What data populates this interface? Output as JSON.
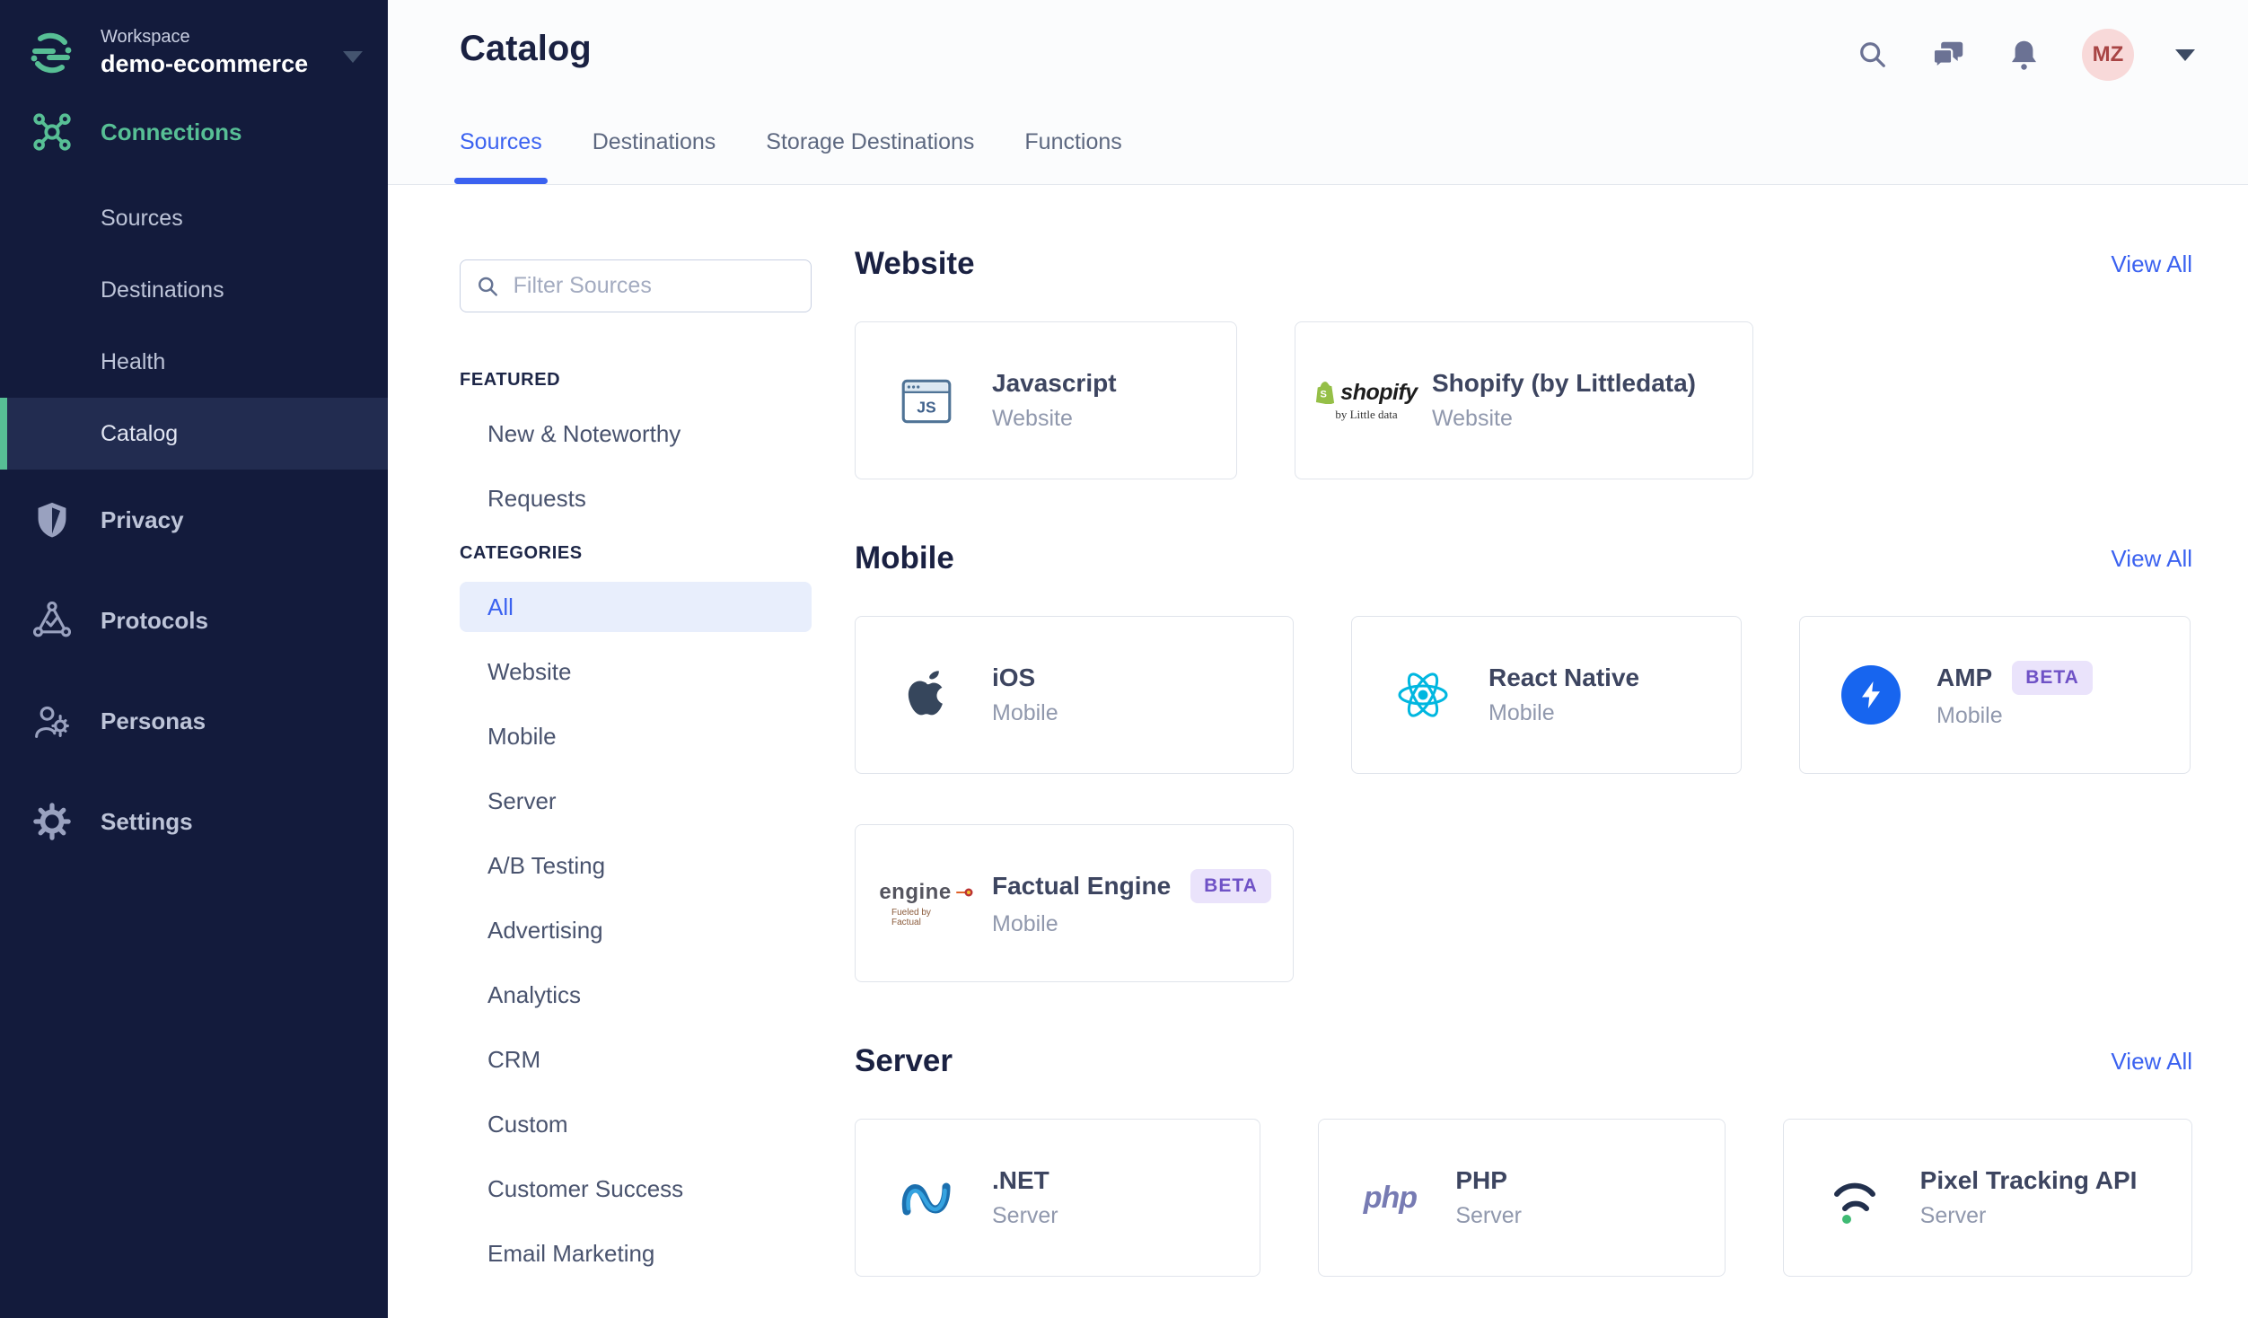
{
  "workspace": {
    "label": "Workspace",
    "name": "demo-ecommerce"
  },
  "sidebar": {
    "connections": {
      "label": "Connections",
      "icon": "connections-icon",
      "items": [
        {
          "label": "Sources",
          "active": false
        },
        {
          "label": "Destinations",
          "active": false
        },
        {
          "label": "Health",
          "active": false
        },
        {
          "label": "Catalog",
          "active": true
        }
      ]
    },
    "bottom": [
      {
        "label": "Privacy",
        "icon": "shield-icon"
      },
      {
        "label": "Protocols",
        "icon": "protocols-icon"
      },
      {
        "label": "Personas",
        "icon": "personas-icon"
      },
      {
        "label": "Settings",
        "icon": "settings-gear-icon"
      }
    ]
  },
  "header": {
    "title": "Catalog",
    "tabs": [
      {
        "label": "Sources",
        "active": true
      },
      {
        "label": "Destinations",
        "active": false
      },
      {
        "label": "Storage Destinations",
        "active": false
      },
      {
        "label": "Functions",
        "active": false
      }
    ],
    "icons": [
      "search-icon",
      "chat-icon",
      "bell-icon"
    ],
    "avatar": "MZ"
  },
  "filters": {
    "placeholder": "Filter Sources",
    "featured_label": "FEATURED",
    "featured": [
      "New & Noteworthy",
      "Requests"
    ],
    "categories_label": "CATEGORIES",
    "active_category": "All",
    "categories": [
      "All",
      "Website",
      "Mobile",
      "Server",
      "A/B Testing",
      "Advertising",
      "Analytics",
      "CRM",
      "Custom",
      "Customer Success",
      "Email Marketing"
    ]
  },
  "sections": [
    {
      "title": "Website",
      "view_all": "View All",
      "cards": [
        {
          "name": "Javascript",
          "category": "Website",
          "icon": "javascript-icon"
        },
        {
          "name": "Shopify (by Littledata)",
          "category": "Website",
          "icon": "shopify-icon"
        }
      ]
    },
    {
      "title": "Mobile",
      "view_all": "View All",
      "cards": [
        {
          "name": "iOS",
          "category": "Mobile",
          "icon": "apple-icon"
        },
        {
          "name": "React Native",
          "category": "Mobile",
          "icon": "react-icon"
        },
        {
          "name": "AMP",
          "category": "Mobile",
          "icon": "amp-icon",
          "badge": "BETA"
        },
        {
          "name": "Factual Engine",
          "category": "Mobile",
          "icon": "factual-engine-icon",
          "badge": "BETA"
        }
      ]
    },
    {
      "title": "Server",
      "view_all": "View All",
      "cards": [
        {
          "name": ".NET",
          "category": "Server",
          "icon": "dotnet-icon"
        },
        {
          "name": "PHP",
          "category": "Server",
          "icon": "php-icon"
        },
        {
          "name": "Pixel Tracking API",
          "category": "Server",
          "icon": "pixel-tracking-icon"
        }
      ]
    }
  ],
  "icon_text": {
    "js_label": "JS",
    "shopify_word": "shopify",
    "shopify_sub": "by Little data",
    "php_word": "php",
    "engine_word": "engine",
    "factual_sub": "Fueled by Factual"
  },
  "colors": {
    "sidebar_bg": "#131b3c",
    "sidebar_active_bg": "#222c50",
    "segment_green": "#57bf95",
    "accent_blue": "#3b62f0",
    "category_active_bg": "#e8eefc",
    "beta_badge_bg": "#eae3fb",
    "beta_badge_text": "#6f52c6",
    "amp_blue": "#1765ef",
    "react_cyan": "#00b7e0",
    "avatar_bg": "#f8d9d9",
    "avatar_text": "#a84444",
    "heading_navy": "#1a2142"
  }
}
